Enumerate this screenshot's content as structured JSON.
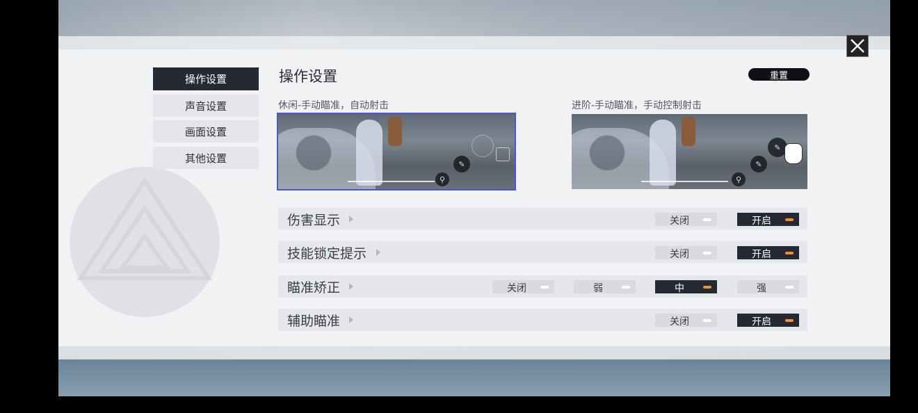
{
  "sidebar": {
    "items": [
      {
        "label": "操作设置",
        "active": true
      },
      {
        "label": "声音设置",
        "active": false
      },
      {
        "label": "画面设置",
        "active": false
      },
      {
        "label": "其他设置",
        "active": false
      }
    ]
  },
  "header": {
    "title": "操作设置",
    "reset_label": "重置"
  },
  "modes": [
    {
      "label": "休闲-手动瞄准，自动射击",
      "selected": true
    },
    {
      "label": "进阶-手动瞄准，手动控制射击",
      "selected": false
    }
  ],
  "settings": [
    {
      "label": "伤害显示",
      "options": [
        "关闭",
        "开启"
      ],
      "selected": "开启"
    },
    {
      "label": "技能锁定提示",
      "options": [
        "关闭",
        "开启"
      ],
      "selected": "开启"
    },
    {
      "label": "瞄准矫正",
      "options": [
        "关闭",
        "弱",
        "中",
        "强"
      ],
      "selected": "中"
    },
    {
      "label": "辅助瞄准",
      "options": [
        "关闭",
        "开启"
      ],
      "selected": "开启"
    }
  ],
  "colors": {
    "active_bg": "#262833",
    "accent": "#f3912a",
    "selection_outline": "#4b55d8"
  },
  "icons": {
    "close": "close-icon",
    "hand": "hand-pointer-icon"
  }
}
